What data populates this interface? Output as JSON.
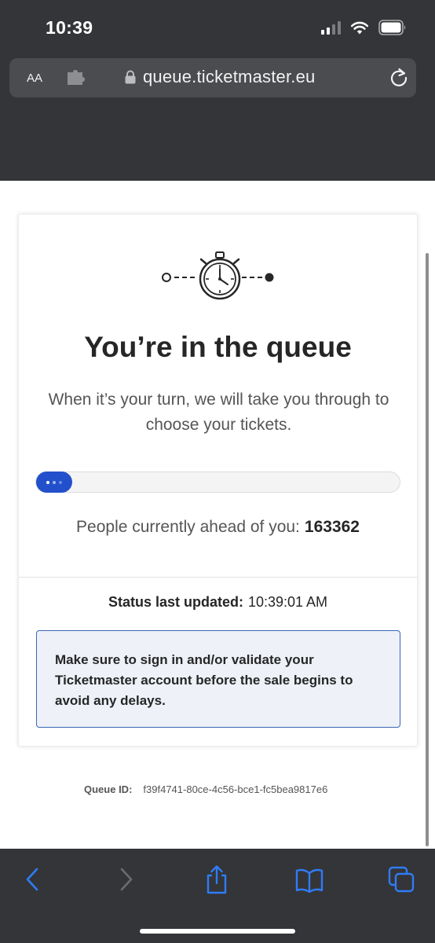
{
  "status_bar": {
    "time": "10:39"
  },
  "address_bar": {
    "aa_label": "AA",
    "url": "queue.ticketmaster.eu"
  },
  "queue": {
    "title": "You’re in the queue",
    "subtitle": "When it’s your turn, we will take you through to choose your tickets.",
    "progress_fraction": 0.1,
    "ahead_label": "People currently ahead of you:",
    "ahead_count": "163362",
    "status_label": "Status last updated:",
    "status_time": "10:39:01 AM",
    "notice": "Make sure to sign in and/or validate your Ticketmaster account before the sale begins to avoid any delays."
  },
  "queue_id": {
    "label": "Queue ID:",
    "value": "f39f4741-80ce-4c56-bce1-fc5bea9817e6"
  },
  "toolbar": {
    "icons": [
      "back-icon",
      "forward-icon",
      "share-icon",
      "bookmarks-icon",
      "tabs-icon"
    ]
  },
  "colors": {
    "accent": "#2250cc",
    "chrome": "#343538",
    "toolbar_icon": "#2f7cf6",
    "notice_border": "#3a66b7",
    "notice_bg": "#eef2f8"
  }
}
